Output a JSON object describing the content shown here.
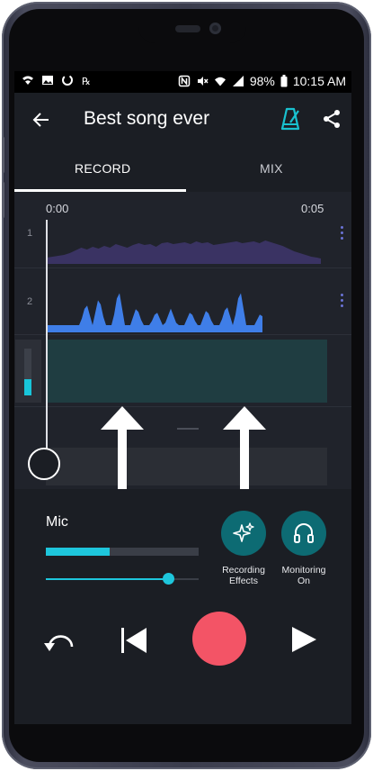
{
  "status_bar": {
    "battery": "98%",
    "time": "10:15 AM"
  },
  "app_bar": {
    "title": "Best song ever",
    "icons": [
      "back-arrow-icon",
      "metronome-icon",
      "share-icon"
    ]
  },
  "tabs": [
    {
      "label": "RECORD",
      "selected": true
    },
    {
      "label": "MIX",
      "selected": false
    }
  ],
  "timeline": {
    "start_time": "0:00",
    "end_time": "0:05",
    "tracks": [
      {
        "number": "1",
        "color": "#3a3363"
      },
      {
        "number": "2",
        "color": "#3f7ee8"
      }
    ],
    "recording_level": 0.35
  },
  "mic": {
    "label": "Mic",
    "input_level": 0.42,
    "gain": 0.8
  },
  "actions": [
    {
      "label_line1": "Recording",
      "label_line2": "Effects",
      "icon": "sparkles-icon"
    },
    {
      "label_line1": "Monitoring",
      "label_line2": "On",
      "icon": "headphones-icon"
    }
  ],
  "colors": {
    "accent": "#1ec6dc",
    "record": "#f35466",
    "button_teal": "#0d6b73",
    "background": "#1b1e24"
  }
}
